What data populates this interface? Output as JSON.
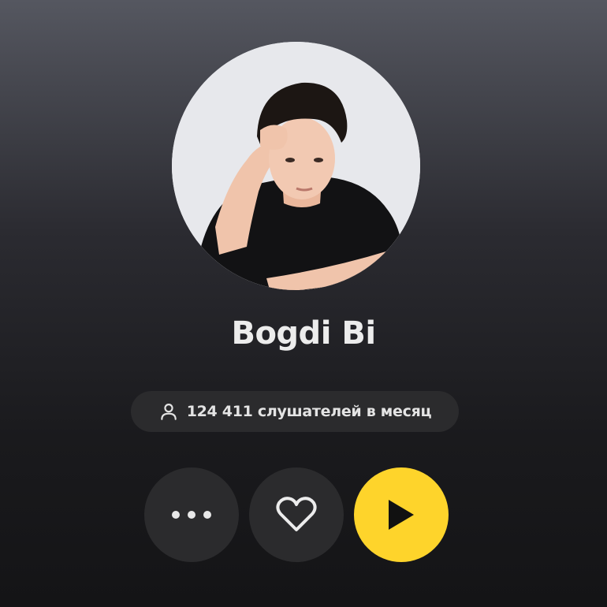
{
  "artist": {
    "name": "Bogdi Bi",
    "listeners_text": "124 411 слушателей в месяц"
  },
  "icons": {
    "listeners": "user-icon",
    "more": "more-dots-icon",
    "like": "heart-icon",
    "play": "play-icon"
  },
  "colors": {
    "play_button": "#fed42b",
    "button_bg": "#2b2b2d",
    "text": "#ececec"
  }
}
